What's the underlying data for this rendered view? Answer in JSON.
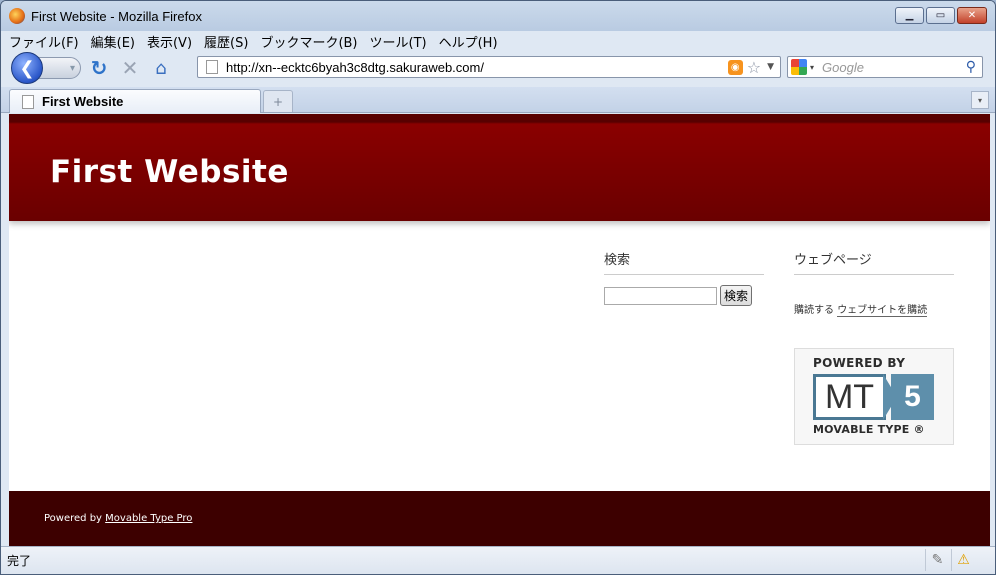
{
  "window": {
    "title": "First Website - Mozilla Firefox"
  },
  "menu": {
    "items": [
      "ファイル(F)",
      "編集(E)",
      "表示(V)",
      "履歴(S)",
      "ブックマーク(B)",
      "ツール(T)",
      "ヘルプ(H)"
    ]
  },
  "nav": {
    "url": "http://xn--ecktc6byah3c8dtg.sakuraweb.com/",
    "search_placeholder": "Google"
  },
  "tabs": {
    "active_title": "First Website",
    "new_tab_symbol": "+"
  },
  "site": {
    "title": "First Website",
    "search_widget_title": "検索",
    "search_button": "検索",
    "pages_widget_title": "ウェブページ",
    "subscribe_prefix": "購読する",
    "subscribe_link": "ウェブサイトを購読",
    "powered_top": "POWERED BY",
    "mt_text": "MT",
    "mt_version": "5",
    "powered_bottom": "MOVABLE TYPE",
    "registered": "®",
    "footer_prefix": "Powered by",
    "footer_link": "Movable Type Pro"
  },
  "status": {
    "text": "完了"
  },
  "colors": {
    "header_red": "#8a0000",
    "footer_dark": "#3d0000",
    "mt_blue": "#5e8fab"
  }
}
